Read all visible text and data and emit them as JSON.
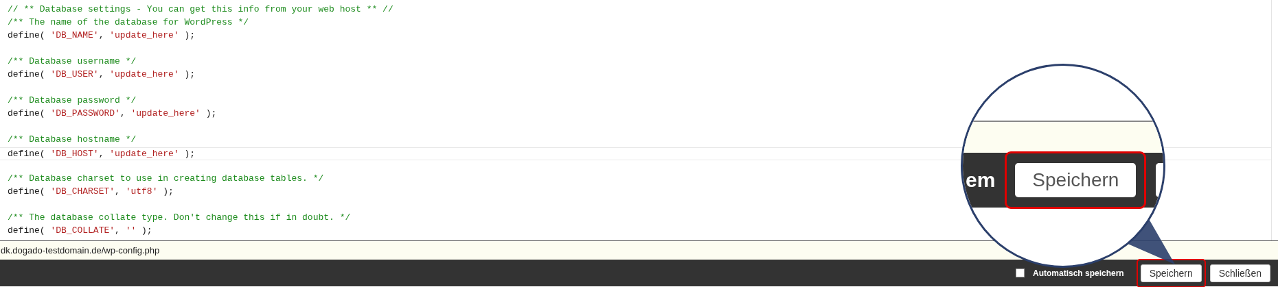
{
  "editor": {
    "lines": [
      {
        "kind": "comment",
        "current": false,
        "text": "// ** Database settings - You can get this info from your web host ** //"
      },
      {
        "kind": "comment",
        "current": false,
        "text": "/** The name of the database for WordPress */"
      },
      {
        "kind": "code",
        "current": false,
        "tokens": [
          {
            "kind": "plain",
            "text": "define( "
          },
          {
            "kind": "string",
            "text": "'DB_NAME'"
          },
          {
            "kind": "plain",
            "text": ", "
          },
          {
            "kind": "string",
            "text": "'update_here'"
          },
          {
            "kind": "plain",
            "text": " );"
          }
        ]
      },
      {
        "kind": "blank"
      },
      {
        "kind": "comment",
        "current": false,
        "text": "/** Database username */"
      },
      {
        "kind": "code",
        "current": false,
        "tokens": [
          {
            "kind": "plain",
            "text": "define( "
          },
          {
            "kind": "string",
            "text": "'DB_USER'"
          },
          {
            "kind": "plain",
            "text": ", "
          },
          {
            "kind": "string",
            "text": "'update_here'"
          },
          {
            "kind": "plain",
            "text": " );"
          }
        ]
      },
      {
        "kind": "blank"
      },
      {
        "kind": "comment",
        "current": false,
        "text": "/** Database password */"
      },
      {
        "kind": "code",
        "current": false,
        "tokens": [
          {
            "kind": "plain",
            "text": "define( "
          },
          {
            "kind": "string",
            "text": "'DB_PASSWORD'"
          },
          {
            "kind": "plain",
            "text": ", "
          },
          {
            "kind": "string",
            "text": "'update_here'"
          },
          {
            "kind": "plain",
            "text": " );"
          }
        ]
      },
      {
        "kind": "blank"
      },
      {
        "kind": "comment",
        "current": false,
        "text": "/** Database hostname */"
      },
      {
        "kind": "code",
        "current": true,
        "tokens": [
          {
            "kind": "plain",
            "text": "define( "
          },
          {
            "kind": "string",
            "text": "'DB_HOST'"
          },
          {
            "kind": "plain",
            "text": ", "
          },
          {
            "kind": "string",
            "text": "'update_here'"
          },
          {
            "kind": "plain",
            "text": " );"
          }
        ]
      },
      {
        "kind": "blank"
      },
      {
        "kind": "comment",
        "current": false,
        "text": "/** Database charset to use in creating database tables. */"
      },
      {
        "kind": "code",
        "current": false,
        "tokens": [
          {
            "kind": "plain",
            "text": "define( "
          },
          {
            "kind": "string",
            "text": "'DB_CHARSET'"
          },
          {
            "kind": "plain",
            "text": ", "
          },
          {
            "kind": "string",
            "text": "'utf8'"
          },
          {
            "kind": "plain",
            "text": " );"
          }
        ]
      },
      {
        "kind": "blank"
      },
      {
        "kind": "comment",
        "current": false,
        "text": "/** The database collate type. Don't change this if in doubt. */"
      },
      {
        "kind": "code",
        "current": false,
        "tokens": [
          {
            "kind": "plain",
            "text": "define( "
          },
          {
            "kind": "string",
            "text": "'DB_COLLATE'"
          },
          {
            "kind": "plain",
            "text": ", "
          },
          {
            "kind": "string",
            "text": "''"
          },
          {
            "kind": "plain",
            "text": " );"
          }
        ]
      }
    ]
  },
  "file_path": "dk.dogado-testdomain.de/wp-config.php",
  "footer": {
    "autosave": {
      "label": "Automatisch speichern",
      "checked": false
    },
    "buttons": [
      {
        "label": "Speichern",
        "highlighted": true
      },
      {
        "label": "Schließen",
        "highlighted": false
      }
    ]
  },
  "magnifier": {
    "fragment": "em",
    "button": "Speichern"
  }
}
